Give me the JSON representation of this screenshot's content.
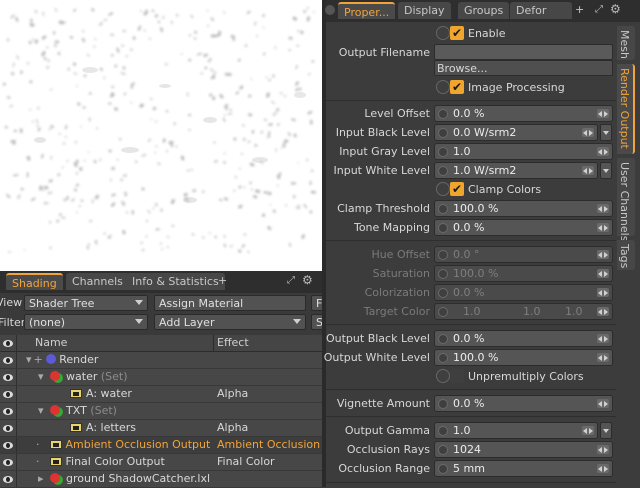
{
  "shading_panel": {
    "tabs": [
      "Shading",
      "Channels",
      "Info & Statistics"
    ],
    "add_tab": "+",
    "view_label": "View",
    "view_value": "Shader Tree",
    "assign_material": "Assign Material",
    "f_button": "F",
    "filter_label": "Filter",
    "filter_value": "(none)",
    "add_layer": "Add Layer",
    "s_button": "S",
    "col_name": "Name",
    "col_effect": "Effect",
    "rows": [
      {
        "name": "Render",
        "set": "",
        "effect": ""
      },
      {
        "name": "water",
        "set": "(Set)",
        "effect": ""
      },
      {
        "name": "A: water",
        "set": "",
        "effect": "Alpha"
      },
      {
        "name": "TXT",
        "set": "(Set)",
        "effect": ""
      },
      {
        "name": "A: letters",
        "set": "",
        "effect": "Alpha"
      },
      {
        "name": "Ambient Occlusion Output",
        "set": "",
        "effect": "Ambient Occlusion"
      },
      {
        "name": "Final Color Output",
        "set": "",
        "effect": "Final Color"
      },
      {
        "name": "ground ShadowCatcher.lxl",
        "set": "",
        "effect": ""
      }
    ]
  },
  "properties_panel": {
    "tabs": [
      "Proper...",
      "Display",
      "Groups",
      "Defor"
    ],
    "add_tab": "+",
    "side_tabs": [
      "Mesh",
      "Render Output",
      "User Channels",
      "Tags"
    ],
    "enable_label": "Enable",
    "output_filename_label": "Output Filename",
    "browse_label": "Browse...",
    "image_processing_label": "Image Processing",
    "level_offset": {
      "label": "Level Offset",
      "value": "0.0 %"
    },
    "input_black": {
      "label": "Input Black Level",
      "value": "0.0 W/srm2"
    },
    "input_gray": {
      "label": "Input Gray Level",
      "value": "1.0"
    },
    "input_white": {
      "label": "Input White Level",
      "value": "1.0 W/srm2"
    },
    "clamp_colors_label": "Clamp Colors",
    "clamp_threshold": {
      "label": "Clamp Threshold",
      "value": "100.0 %"
    },
    "tone_mapping": {
      "label": "Tone Mapping",
      "value": "0.0 %"
    },
    "hue_offset": {
      "label": "Hue Offset",
      "value": "0.0 °"
    },
    "saturation": {
      "label": "Saturation",
      "value": "100.0 %"
    },
    "colorization": {
      "label": "Colorization",
      "value": "0.0 %"
    },
    "target_color": {
      "label": "Target Color",
      "r": "1.0",
      "g": "1.0",
      "b": "1.0"
    },
    "output_black": {
      "label": "Output Black Level",
      "value": "0.0 %"
    },
    "output_white": {
      "label": "Output White Level",
      "value": "100.0 %"
    },
    "unpremultiply_label": "Unpremultiply Colors",
    "vignette": {
      "label": "Vignette Amount",
      "value": "0.0 %"
    },
    "output_gamma": {
      "label": "Output Gamma",
      "value": "1.0"
    },
    "occlusion_rays": {
      "label": "Occlusion Rays",
      "value": "1024"
    },
    "occlusion_range": {
      "label": "Occlusion Range",
      "value": "5 mm"
    }
  }
}
